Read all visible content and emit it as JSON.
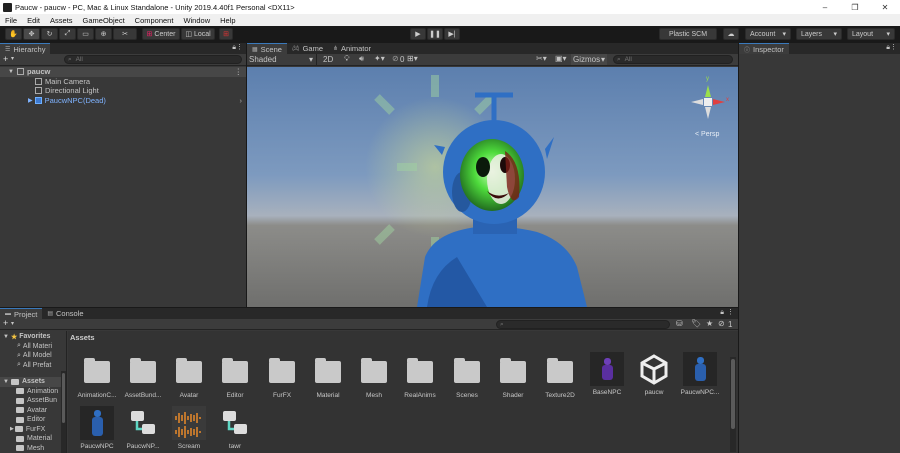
{
  "window": {
    "title": "Paucw - paucw - PC, Mac & Linux Standalone - Unity 2019.4.40f1 Personal <DX11>",
    "controls": [
      "–",
      "❐",
      "✕"
    ]
  },
  "menu": [
    "File",
    "Edit",
    "Assets",
    "GameObject",
    "Component",
    "Window",
    "Help"
  ],
  "toolbar": {
    "pivot_label": "Center",
    "space_label": "Local",
    "plastic_label": "Plastic SCM",
    "account_label": "Account",
    "layers_label": "Layers",
    "layout_label": "Layout"
  },
  "hierarchy": {
    "tab_label": "Hierarchy",
    "search_placeholder": "All",
    "scene_name": "paucw",
    "items": [
      "Main Camera",
      "Directional Light",
      "PaucwNPC(Dead)"
    ]
  },
  "scene": {
    "tabs": [
      "Scene",
      "Game",
      "Animator"
    ],
    "shading_mode": "Shaded",
    "mode_2d": "2D",
    "fx_count": "0",
    "gizmos_label": "Gizmos",
    "search_placeholder": "All",
    "gizmo_axes": {
      "y": "y",
      "x": "x",
      "z": "z"
    },
    "persp_label": "Persp"
  },
  "inspector": {
    "tab_label": "Inspector"
  },
  "project": {
    "tabs": [
      "Project",
      "Console"
    ],
    "favorites_label": "Favorites",
    "favorites": [
      "All Materi",
      "All Model",
      "All Prefat"
    ],
    "assets_root": "Assets",
    "tree": [
      "Animation",
      "AssetBun",
      "Avatar",
      "Editor",
      "FurFX",
      "Material",
      "Mesh"
    ],
    "breadcrumb": "Assets",
    "hidden_count": "1",
    "assets_row1": [
      "AnimationC...",
      "AssetBund...",
      "Avatar",
      "Editor",
      "FurFX",
      "Material",
      "Mesh",
      "RealAnims",
      "Scenes",
      "Shader",
      "Texture2D",
      "BaseNPC",
      "paucw",
      "PaucwNPC..."
    ],
    "assets_row2": [
      "PaucwNPC",
      "PaucwNP...",
      "Scream",
      "tawr"
    ]
  },
  "colors": {
    "accent_blue": "#3a79bb",
    "sky_top": "#5c7fae",
    "character_blue": "#2f6fc4",
    "face_green": "#5cff5c",
    "audio_orange": "#e98b2a",
    "animator_teal": "#5fd6c4"
  }
}
